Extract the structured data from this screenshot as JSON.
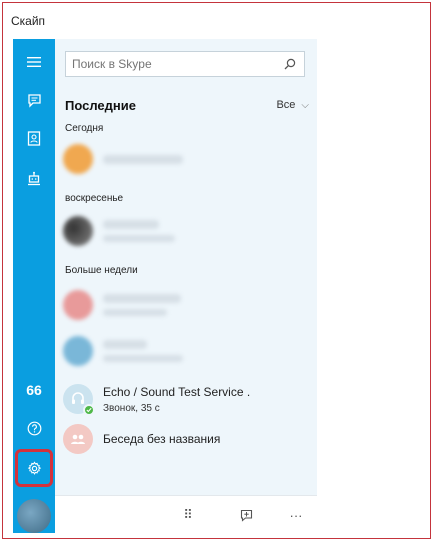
{
  "window": {
    "title": "Скайп"
  },
  "colors": {
    "sidebar": "#0a9ee0",
    "highlight": "#d3323c",
    "online": "#4fb848"
  },
  "search": {
    "placeholder": "Поиск в Skype"
  },
  "recent": {
    "title": "Последние",
    "filter": "Все"
  },
  "sections": {
    "today": "Сегодня",
    "sunday": "воскресенье",
    "older": "Больше недели"
  },
  "sidebar": {
    "mood_label": "66",
    "icons": [
      "menu-icon",
      "chat-icon",
      "contacts-icon",
      "bot-icon",
      "mood-icon",
      "help-icon",
      "gear-icon"
    ]
  },
  "contacts_visible": [
    {
      "name": "Echo / Sound Test Service .",
      "subtitle": "Звонок, 35 с"
    },
    {
      "name": "Беседа без названия"
    }
  ],
  "bottombar": {
    "dialpad": "⠿",
    "more": "···"
  }
}
